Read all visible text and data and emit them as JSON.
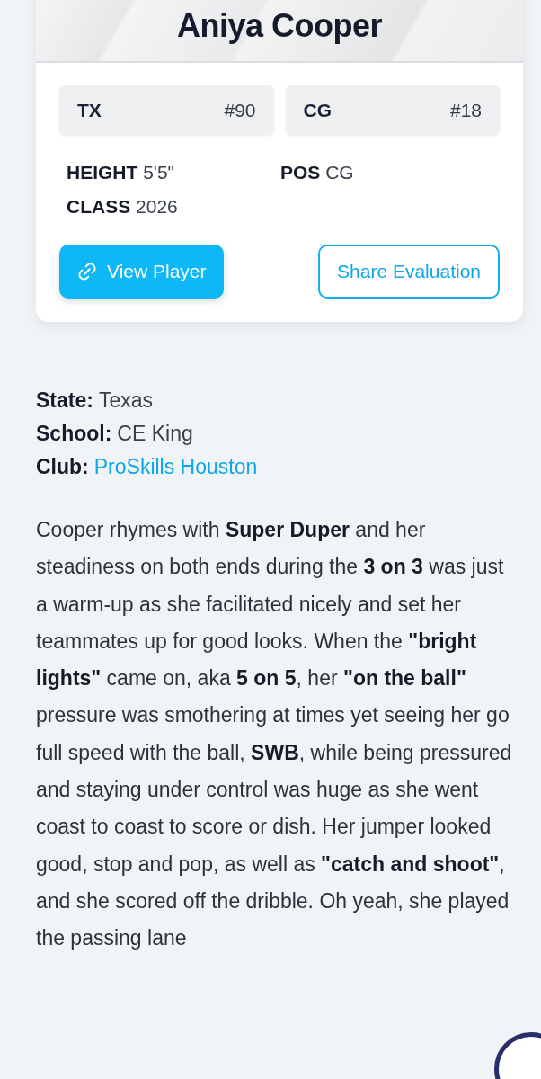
{
  "player": {
    "name": "Aniya Cooper",
    "badges": [
      {
        "label": "TX",
        "rank": "#90"
      },
      {
        "label": "CG",
        "rank": "#18"
      }
    ],
    "details": [
      {
        "label": "HEIGHT",
        "value": "5'5\""
      },
      {
        "label": "POS",
        "value": "CG"
      },
      {
        "label": "CLASS",
        "value": "2026"
      }
    ],
    "buttons": [
      {
        "kind": "primary",
        "label": "View Player"
      },
      {
        "kind": "outline",
        "label": "Share Evaluation"
      }
    ]
  },
  "info": [
    {
      "kind": "text",
      "label": "State:",
      "value": "Texas"
    },
    {
      "kind": "text",
      "label": "School:",
      "value": "CE King"
    },
    {
      "kind": "link",
      "label": "Club:",
      "value": "ProSkills Houston"
    }
  ],
  "evaluation": "Cooper rhymes with **Super Duper** and her steadiness on both ends during the **3 on 3** was just a warm-up as she facilitated nicely and set her teammates up for good looks. When the **\"bright lights\"** came on, aka **5 on 5**, her **\"on the ball\"** pressure was smothering at times yet seeing her go full speed with the ball, **SWB**, while being pressured and staying under control was huge as she went coast to coast to score or dish. Her jumper looked good, stop and pop, as well as **\"catch and shoot\"**, and she scored off the dribble. Oh yeah, she played the passing lane"
}
